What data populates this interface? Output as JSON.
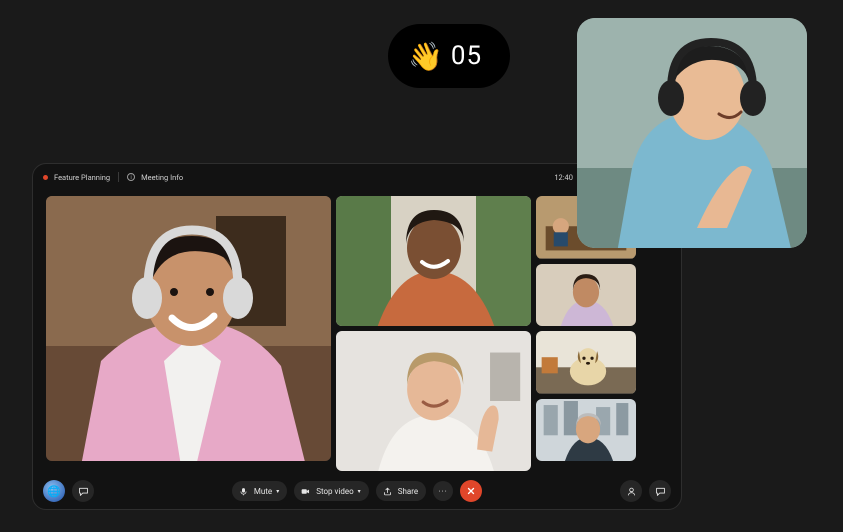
{
  "reaction": {
    "emoji": "👋",
    "count": "05"
  },
  "meeting": {
    "title": "Feature Planning",
    "info_label": "Meeting Info",
    "time": "12:40"
  },
  "toolbar": {
    "mute_label": "Mute",
    "stop_video_label": "Stop video",
    "share_label": "Share"
  },
  "colors": {
    "accent": "#e0462a",
    "panel": "#121212",
    "bg": "#1a1a1a"
  }
}
